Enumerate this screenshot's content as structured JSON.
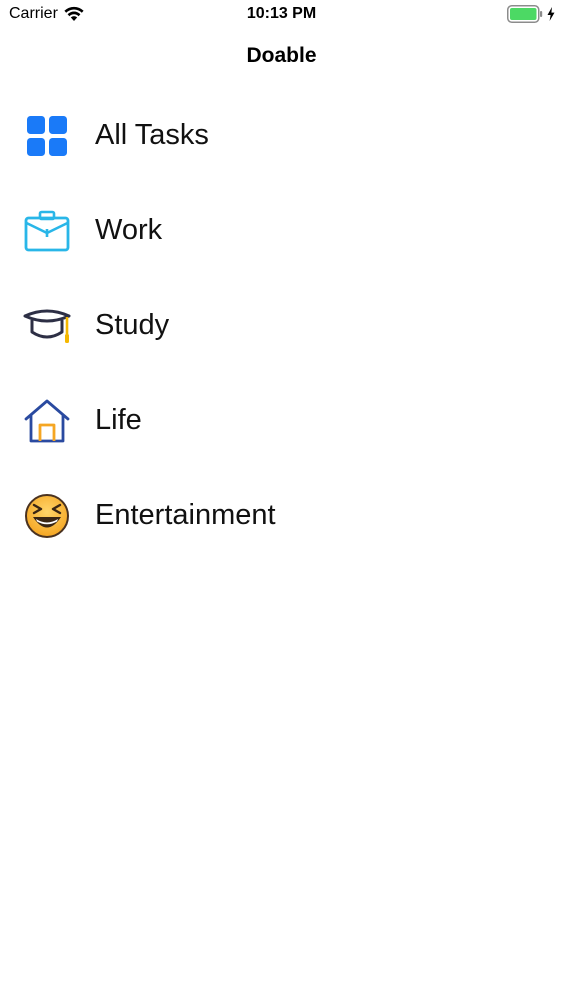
{
  "status_bar": {
    "carrier": "Carrier",
    "time": "10:13 PM",
    "battery_color": "#4cd964"
  },
  "nav": {
    "title": "Doable"
  },
  "categories": [
    {
      "label": "All Tasks",
      "icon": "grid-icon",
      "color": "#1a7af8"
    },
    {
      "label": "Work",
      "icon": "briefcase-icon",
      "color": "#29b6e8"
    },
    {
      "label": "Study",
      "icon": "graduation-cap-icon",
      "color": "#2d2f45"
    },
    {
      "label": "Life",
      "icon": "house-icon",
      "color": "#2a4aa0"
    },
    {
      "label": "Entertainment",
      "icon": "laughing-face-icon",
      "color": "#f5a623"
    }
  ]
}
